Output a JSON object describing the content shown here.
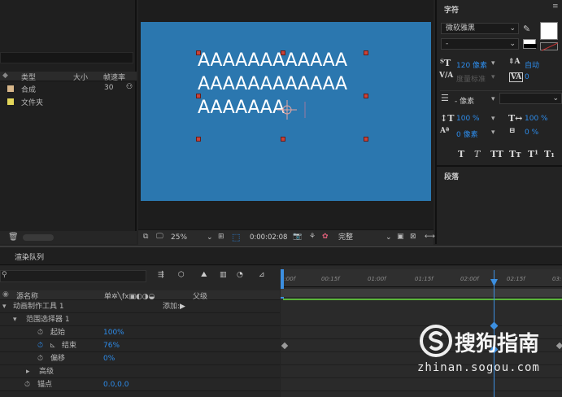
{
  "project": {
    "columns": {
      "type": "类型",
      "size": "大小",
      "fps": "帧速率"
    },
    "items": [
      {
        "name": "合成",
        "fps": "30",
        "color": "#d7b68a"
      },
      {
        "name": "文件夹",
        "fps": "",
        "color": "#e3d65a"
      }
    ]
  },
  "viewer": {
    "text_lines": [
      "AAAAAAAAAAAA",
      "AAAAAAAAAAAA",
      "AAAAAAA"
    ],
    "zoom": "25%",
    "timecode": "0:00:02:08",
    "resolution": "完整"
  },
  "character": {
    "title": "字符",
    "font_family": "微软雅黑",
    "font_style": "-",
    "font_size": "120 像素",
    "leading": "自动",
    "kerning": "度量标准",
    "tracking": "0",
    "stroke_width": "- 像素",
    "vertical_scale": "100 %",
    "horizontal_scale": "100 %",
    "baseline_shift": "0 像素",
    "tsume": "0 %",
    "typo_buttons": [
      "T",
      "T",
      "TT",
      "Tт",
      "T¹",
      "T₁"
    ],
    "paragraph_title": "段落"
  },
  "timeline": {
    "tab_label": "渲染队列",
    "columns": {
      "source": "源名称",
      "switches": "单✲╲fx▣◐◑◒",
      "parent": "父级"
    },
    "add_label": "添加:",
    "rows": [
      {
        "label": "动画制作工具 1",
        "value": ""
      },
      {
        "label": "范围选择器 1",
        "value": ""
      },
      {
        "label": "起始",
        "value": "100%"
      },
      {
        "label": "结束",
        "value": "76%"
      },
      {
        "label": "偏移",
        "value": "0%"
      },
      {
        "label": "高级",
        "value": ""
      },
      {
        "label": "锚点",
        "value": "0.0,0.0"
      }
    ],
    "ruler_labels": [
      "0:00f",
      "00:15f",
      "01:00f",
      "01:15f",
      "02:00f",
      "02:15f",
      "03:"
    ]
  },
  "watermark": {
    "brand": "搜狗指南",
    "url": "zhinan.sogou.com"
  },
  "colors": {
    "accent": "#2d8ceb",
    "canvas": "#2b77af",
    "keyline": "#5ab43a"
  }
}
